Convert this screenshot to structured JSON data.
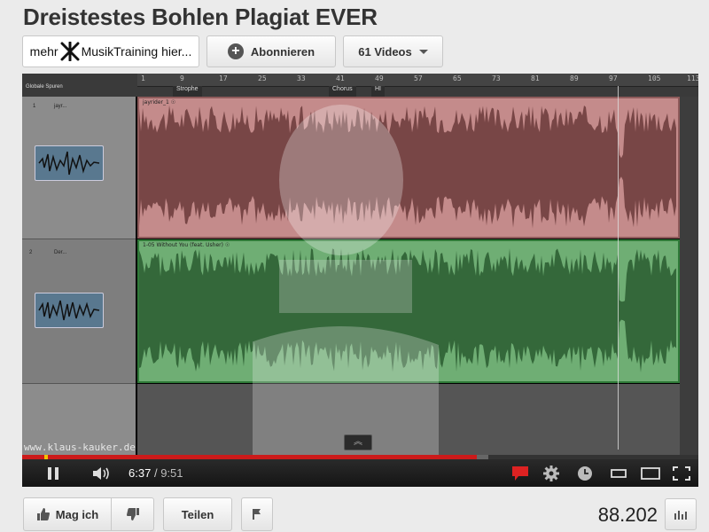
{
  "video_title": "Dreistestes Bohlen Plagiat EVER",
  "channel_bar": {
    "channel_link_prefix": "mehr",
    "channel_link_label": "MusikTraining hier...",
    "subscribe_label": "Abonnieren",
    "videos_label": "61 Videos"
  },
  "daw": {
    "global_label": "Globale Spuren",
    "track1_name": "jayr...",
    "track2_name": "Der...",
    "track_numbers": [
      "1",
      "2"
    ],
    "section_labels": [
      "Strophe",
      "Chorus",
      "HI"
    ],
    "ruler_numbers": [
      "1",
      "9",
      "17",
      "25",
      "33",
      "41",
      "49",
      "57",
      "65",
      "73",
      "81",
      "89",
      "97",
      "105",
      "113"
    ],
    "clip1_name": "jayrider_1 ☉",
    "clip2_name": "1-05 Without You (feat. Usher) ☉",
    "colors": {
      "red_lane": "#c48b8b",
      "green_lane": "#6fae74"
    }
  },
  "watermark": "www.klaus-kauker.de",
  "player": {
    "current_time": "6:37",
    "time_separator": "/",
    "duration": "9:51",
    "progress_fraction": 0.672,
    "buffered_fraction": 0.69,
    "accent_color": "#cc1a1a",
    "icons": [
      "pause-icon",
      "volume-icon",
      "annotations-icon",
      "settings-icon",
      "watch-later-icon",
      "small-player-icon",
      "large-player-icon",
      "fullscreen-icon"
    ]
  },
  "actions": {
    "like_label": "Mag ich",
    "share_label": "Teilen",
    "view_count": "88.202"
  }
}
